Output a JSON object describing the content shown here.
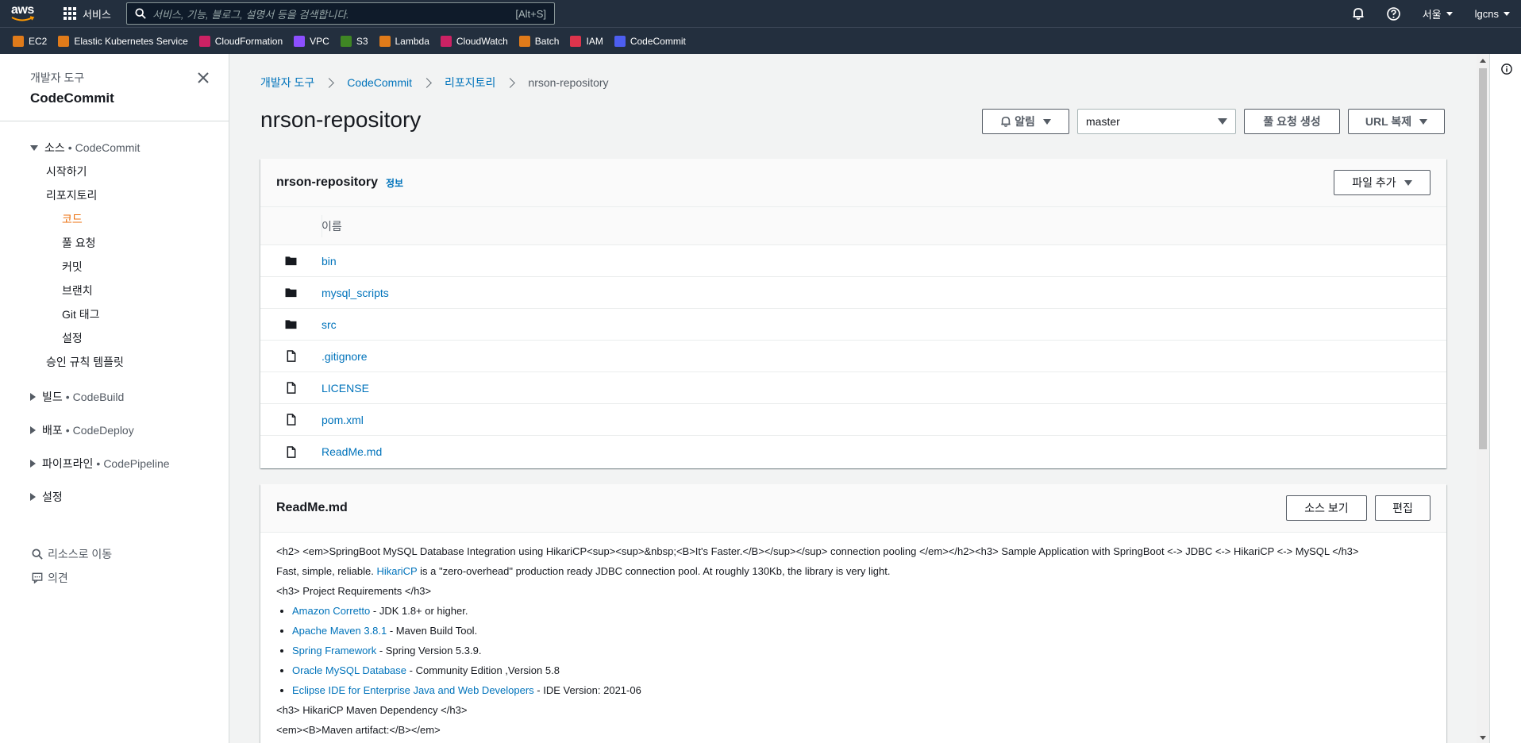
{
  "topnav": {
    "logo_text": "aws",
    "services_label": "서비스",
    "search_placeholder": "서비스, 기능, 블로그, 설명서 등을 검색합니다.",
    "search_shortcut": "[Alt+S]",
    "region": "서울",
    "account": "lgcns"
  },
  "favorites": [
    {
      "label": "EC2",
      "color": "#e07b1a",
      "icon": "ec2-icon"
    },
    {
      "label": "Elastic Kubernetes Service",
      "color": "#e07b1a",
      "icon": "eks-icon"
    },
    {
      "label": "CloudFormation",
      "color": "#cc2264",
      "icon": "cloudformation-icon"
    },
    {
      "label": "VPC",
      "color": "#8c4fff",
      "icon": "vpc-icon"
    },
    {
      "label": "S3",
      "color": "#3f8624",
      "icon": "s3-icon"
    },
    {
      "label": "Lambda",
      "color": "#e07b1a",
      "icon": "lambda-icon"
    },
    {
      "label": "CloudWatch",
      "color": "#cc2264",
      "icon": "cloudwatch-icon"
    },
    {
      "label": "Batch",
      "color": "#e07b1a",
      "icon": "batch-icon"
    },
    {
      "label": "IAM",
      "color": "#dd344c",
      "icon": "iam-icon"
    },
    {
      "label": "CodeCommit",
      "color": "#4d5ef0",
      "icon": "codecommit-icon"
    }
  ],
  "sidebar": {
    "subtitle": "개발자 도구",
    "title": "CodeCommit",
    "source_section": {
      "label": "소스",
      "service": "CodeCommit"
    },
    "source_items": {
      "getting_started": "시작하기",
      "repositories": "리포지토리",
      "code": "코드",
      "pull_requests": "풀 요청",
      "commits": "커밋",
      "branches": "브랜치",
      "git_tags": "Git 태그",
      "settings": "설정",
      "approval_templates": "승인 규칙 템플릿"
    },
    "build_section": {
      "label": "빌드",
      "service": "CodeBuild"
    },
    "deploy_section": {
      "label": "배포",
      "service": "CodeDeploy"
    },
    "pipeline_section": {
      "label": "파이프라인",
      "service": "CodePipeline"
    },
    "settings_section": {
      "label": "설정"
    },
    "go_to_resource": "리소스로 이동",
    "feedback": "의견",
    "bullet": "•"
  },
  "breadcrumb": [
    "개발자 도구",
    "CodeCommit",
    "리포지토리",
    "nrson-repository"
  ],
  "page": {
    "title": "nrson-repository",
    "notify_label": "알림",
    "branch": "master",
    "create_pr_label": "풀 요청 생성",
    "clone_url_label": "URL 복제"
  },
  "repo_panel": {
    "title": "nrson-repository",
    "info_label": "정보",
    "add_file_label": "파일 추가",
    "column_name": "이름",
    "files": [
      {
        "name": "bin",
        "type": "folder"
      },
      {
        "name": "mysql_scripts",
        "type": "folder"
      },
      {
        "name": "src",
        "type": "folder"
      },
      {
        "name": ".gitignore",
        "type": "file"
      },
      {
        "name": "LICENSE",
        "type": "file"
      },
      {
        "name": "pom.xml",
        "type": "file"
      },
      {
        "name": "ReadMe.md",
        "type": "file"
      }
    ]
  },
  "readme": {
    "title": "ReadMe.md",
    "view_source_label": "소스 보기",
    "edit_label": "편집",
    "line1": "<h2> <em>SpringBoot MySQL Database Integration using HikariCP<sup><sup>&nbsp;<B>It's Faster.</B></sup></sup> connection pooling </em></h2><h3> Sample Application with SpringBoot <-> JDBC <-> HikariCP <-> MySQL </h3>",
    "line2_pre": "Fast, simple, reliable. ",
    "line2_link": "HikariCP",
    "line2_post": " is a \"zero-overhead\" production ready JDBC connection pool. At roughly 130Kb, the library is very light.",
    "line3": "<h3> Project Requirements </h3>",
    "requirements": [
      {
        "link": "Amazon Corretto",
        "text": " - JDK 1.8+ or higher."
      },
      {
        "link": "Apache Maven 3.8.1",
        "text": " - Maven Build Tool."
      },
      {
        "link": "Spring Framework",
        "text": " - Spring Version 5.3.9."
      },
      {
        "link": "Oracle MySQL Database",
        "text": " - Community Edition ,Version 5.8"
      },
      {
        "link": "Eclipse IDE for Enterprise Java and Web Developers",
        "text": " - IDE Version: 2021-06"
      }
    ],
    "line4": "<h3> HikariCP Maven Dependency </h3>",
    "line5": "<em><B>Maven artifact:</B></em>"
  },
  "colors": {
    "nav_bg": "#232f3e",
    "link": "#0073bb",
    "active": "#ec7211"
  }
}
